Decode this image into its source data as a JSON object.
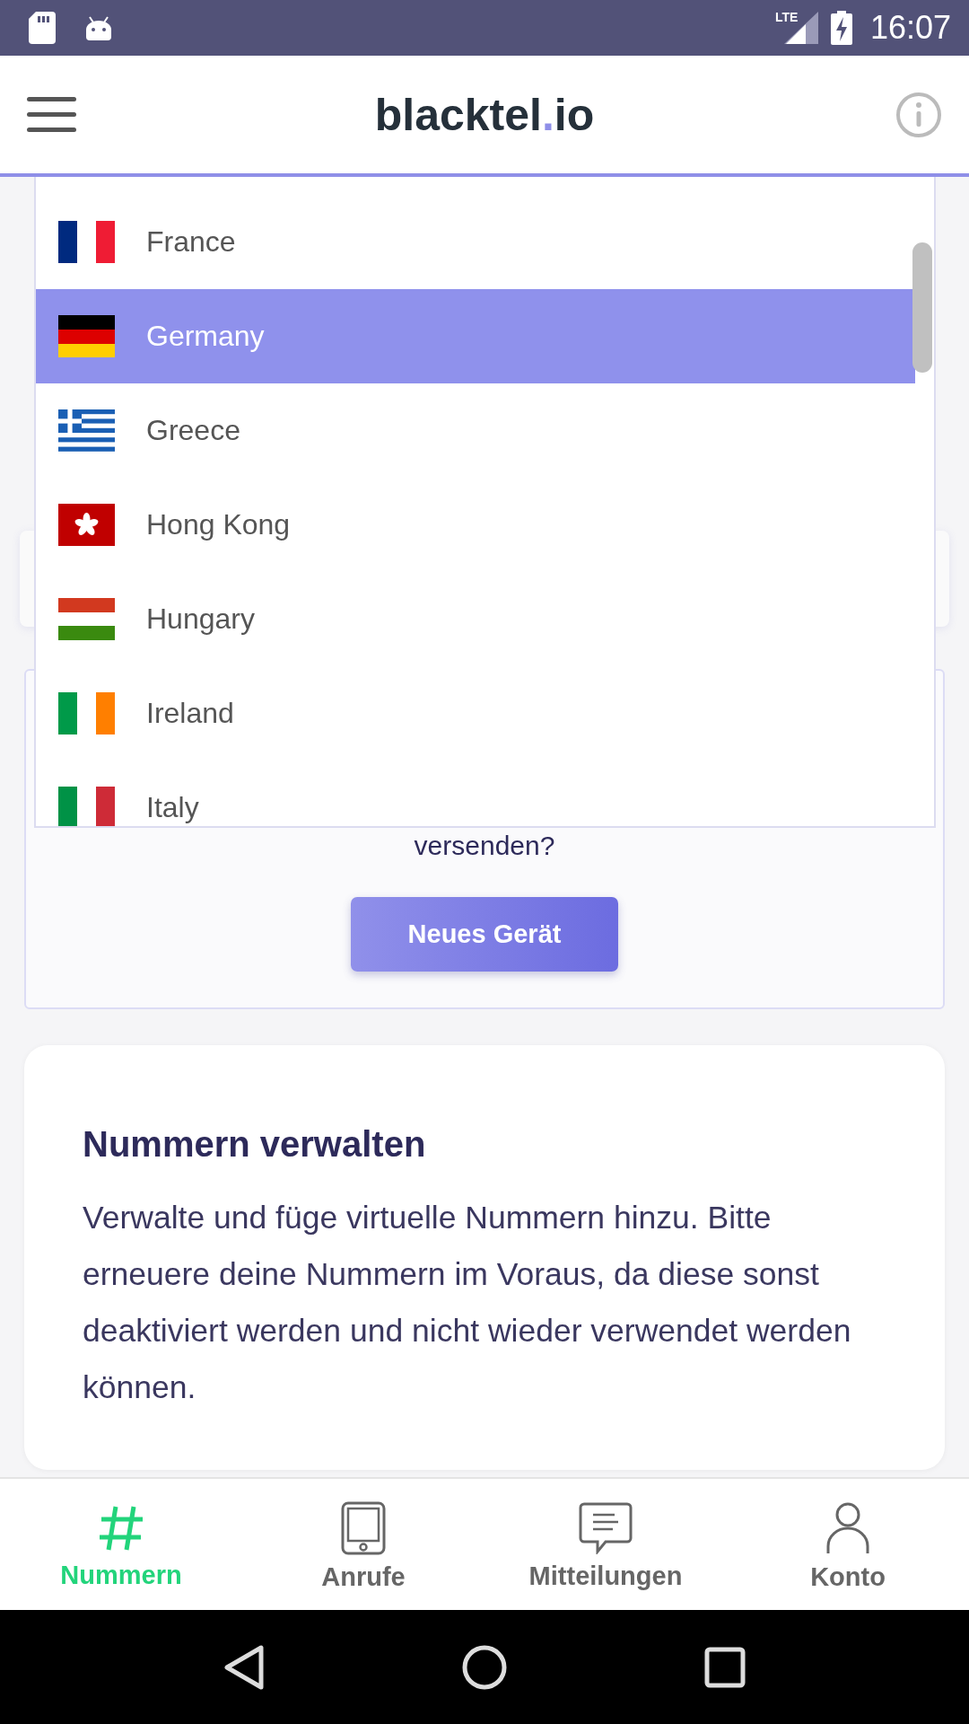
{
  "status_bar": {
    "network": "LTE",
    "time": "16:07"
  },
  "header": {
    "logo": {
      "name": "blacktel",
      "dot": ".",
      "tld": "io"
    }
  },
  "country_dropdown": {
    "items": [
      {
        "name": "France",
        "kind": "fr",
        "selected": false
      },
      {
        "name": "Germany",
        "kind": "de",
        "selected": true
      },
      {
        "name": "Greece",
        "kind": "gr",
        "selected": false
      },
      {
        "name": "Hong Kong",
        "kind": "hk",
        "selected": false
      },
      {
        "name": "Hungary",
        "kind": "hu",
        "selected": false
      },
      {
        "name": "Ireland",
        "kind": "ie",
        "selected": false
      },
      {
        "name": "Italy",
        "kind": "it",
        "selected": false
      }
    ]
  },
  "device_card": {
    "text": "versenden?",
    "button": "Neues Gerät"
  },
  "numbers_card": {
    "title": "Nummern verwalten",
    "text": "Verwalte und füge virtuelle Nummern hinzu. Bitte erneuere deine Nummern im Voraus, da diese sonst deaktiviert werden und nicht wieder verwendet werden können."
  },
  "bottom_nav": {
    "items": [
      {
        "label": "Nummern",
        "kind": "hash",
        "selected": true
      },
      {
        "label": "Anrufe",
        "kind": "phone",
        "selected": false
      },
      {
        "label": "Mitteilungen",
        "kind": "message",
        "selected": false
      },
      {
        "label": "Konto",
        "kind": "person",
        "selected": false
      }
    ]
  }
}
